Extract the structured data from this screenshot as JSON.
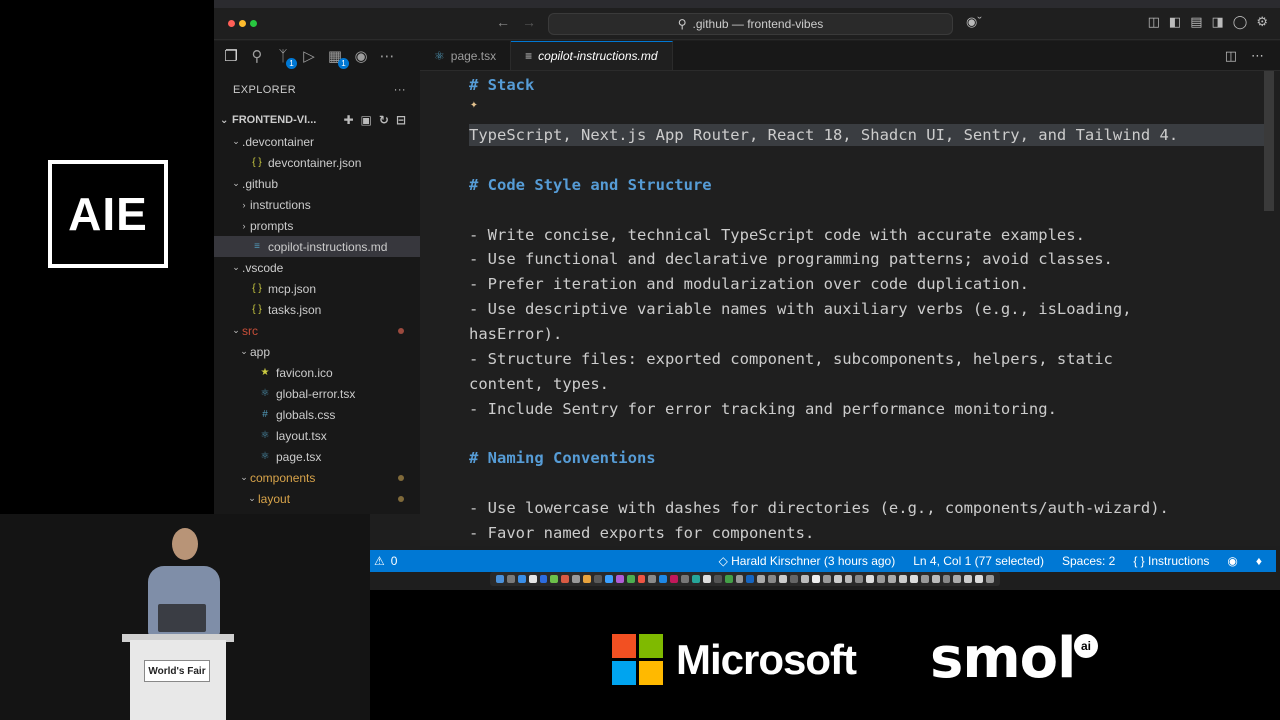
{
  "conference": {
    "logo_text": "AIE",
    "podium_label": "World's Fair"
  },
  "sponsors": {
    "microsoft": "Microsoft",
    "smol": "smol",
    "smol_badge": "ai"
  },
  "titlebar": {
    "search_text": ".github — frontend-vibes"
  },
  "sidebar": {
    "explorer_label": "EXPLORER",
    "more_label": "···",
    "root_folder": "FRONTEND-VI...",
    "tree": [
      {
        "label": ".devcontainer",
        "type": "folder",
        "depth": 1,
        "open": true
      },
      {
        "label": "devcontainer.json",
        "type": "json",
        "depth": 2
      },
      {
        "label": ".github",
        "type": "folder",
        "depth": 1,
        "open": true
      },
      {
        "label": "instructions",
        "type": "folder",
        "depth": 2,
        "open": false
      },
      {
        "label": "prompts",
        "type": "folder",
        "depth": 2,
        "open": false
      },
      {
        "label": "copilot-instructions.md",
        "type": "md",
        "depth": 2,
        "selected": true
      },
      {
        "label": ".vscode",
        "type": "folder",
        "depth": 1,
        "open": true
      },
      {
        "label": "mcp.json",
        "type": "json",
        "depth": 2
      },
      {
        "label": "tasks.json",
        "type": "json",
        "depth": 2
      },
      {
        "label": "src",
        "type": "folder",
        "depth": 1,
        "open": true,
        "git": "red"
      },
      {
        "label": "app",
        "type": "folder",
        "depth": 2,
        "open": true
      },
      {
        "label": "favicon.ico",
        "type": "ico",
        "depth": 3
      },
      {
        "label": "global-error.tsx",
        "type": "tsx",
        "depth": 3
      },
      {
        "label": "globals.css",
        "type": "css",
        "depth": 3
      },
      {
        "label": "layout.tsx",
        "type": "tsx",
        "depth": 3
      },
      {
        "label": "page.tsx",
        "type": "tsx",
        "depth": 3
      },
      {
        "label": "components",
        "type": "folder",
        "depth": 2,
        "open": true,
        "git": "orange"
      },
      {
        "label": "layout",
        "type": "folder",
        "depth": 3,
        "open": true,
        "git": "orange"
      }
    ]
  },
  "tabs": [
    {
      "label": "page.tsx",
      "active": false
    },
    {
      "label": "copilot-instructions.md",
      "active": true
    }
  ],
  "editor": {
    "lines": [
      {
        "text": "# Stack",
        "kind": "heading"
      },
      {
        "text": "",
        "kind": "blank"
      },
      {
        "text": "TypeScript, Next.js App Router, React 18, Shadcn UI, Sentry, and Tailwind 4.",
        "kind": "selected"
      },
      {
        "text": "",
        "kind": "blank"
      },
      {
        "text": "# Code Style and Structure",
        "kind": "heading"
      },
      {
        "text": "",
        "kind": "blank"
      },
      {
        "text": "- Write concise, technical TypeScript code with accurate examples.",
        "kind": "text"
      },
      {
        "text": "- Use functional and declarative programming patterns; avoid classes.",
        "kind": "text"
      },
      {
        "text": "- Prefer iteration and modularization over code duplication.",
        "kind": "text"
      },
      {
        "text": "- Use descriptive variable names with auxiliary verbs (e.g., isLoading,",
        "kind": "text"
      },
      {
        "text": "hasError).",
        "kind": "text"
      },
      {
        "text": "- Structure files: exported component, subcomponents, helpers, static",
        "kind": "text"
      },
      {
        "text": "content, types.",
        "kind": "text"
      },
      {
        "text": "- Include Sentry for error tracking and performance monitoring.",
        "kind": "text"
      },
      {
        "text": "",
        "kind": "blank"
      },
      {
        "text": "# Naming Conventions",
        "kind": "heading"
      },
      {
        "text": "",
        "kind": "blank"
      },
      {
        "text": "- Use lowercase with dashes for directories (e.g., components/auth-wizard).",
        "kind": "text"
      },
      {
        "text": "- Favor named exports for components.",
        "kind": "text"
      }
    ]
  },
  "statusbar": {
    "problems": "0",
    "blame": "Harald Kirschner (3 hours ago)",
    "cursor": "Ln 4, Col 1 (77 selected)",
    "spaces": "Spaces: 2",
    "language": "Instructions"
  },
  "colors": {
    "accent": "#0078d4",
    "heading": "#569cd6",
    "selection": "#3a3d41"
  }
}
